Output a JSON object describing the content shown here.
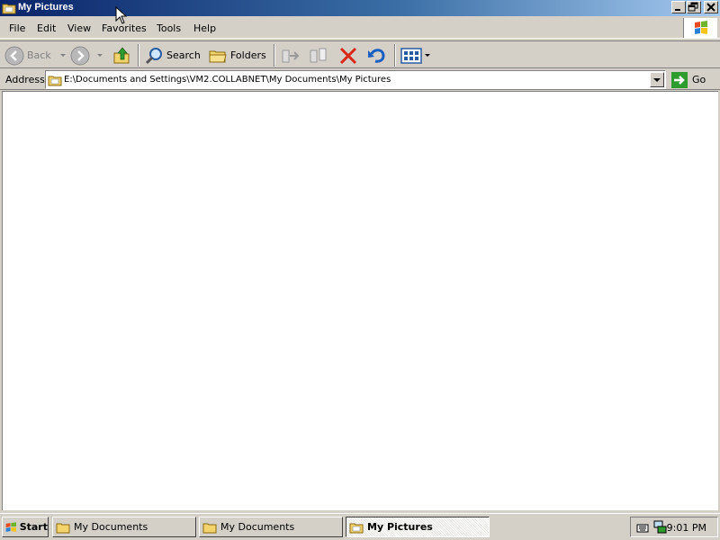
{
  "window": {
    "title": "My Pictures",
    "icon": "folder-icon"
  },
  "menu": {
    "items": [
      "File",
      "Edit",
      "View",
      "Favorites",
      "Tools",
      "Help"
    ]
  },
  "toolbar": {
    "back_label": "Back",
    "search_label": "Search",
    "folders_label": "Folders"
  },
  "address": {
    "label": "Address",
    "value": "E:\\Documents and Settings\\VM2.COLLABNET\\My Documents\\My Pictures",
    "go_label": "Go"
  },
  "taskbar": {
    "start_label": "Start",
    "tasks": [
      {
        "label": "My Documents",
        "active": false
      },
      {
        "label": "My Documents",
        "active": false
      },
      {
        "label": "My Pictures",
        "active": true
      }
    ],
    "clock": "9:01 PM"
  },
  "colors": {
    "title_start": "#0a246a",
    "title_end": "#a6caf0",
    "face": "#d4d0c8"
  }
}
